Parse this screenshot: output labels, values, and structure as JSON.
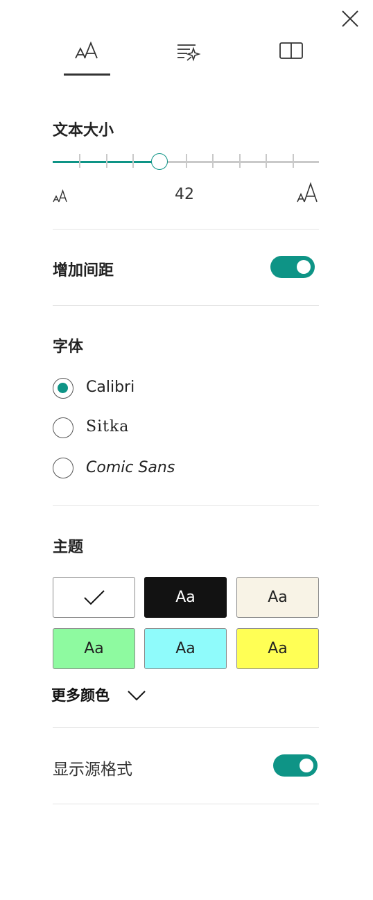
{
  "tabs": [
    {
      "id": "text-options",
      "icon": "text-size-icon",
      "selected": true
    },
    {
      "id": "grammar-options",
      "icon": "text-sparkle-icon",
      "selected": false
    },
    {
      "id": "reading-preferences",
      "icon": "book-icon",
      "selected": false
    }
  ],
  "text_size": {
    "title": "文本大小",
    "value": "42",
    "slider_fraction": 0.4
  },
  "spacing": {
    "label": "增加间距",
    "on": true
  },
  "font": {
    "title": "字体",
    "options": [
      {
        "label": "Calibri",
        "selected": true
      },
      {
        "label": "Sitka",
        "selected": false
      },
      {
        "label": "Comic Sans",
        "selected": false
      }
    ]
  },
  "theme": {
    "title": "主题",
    "sample": "Aa",
    "swatches": [
      {
        "bg": "#ffffff",
        "fg": "#111111",
        "selected": true
      },
      {
        "bg": "#121212",
        "fg": "#ffffff",
        "selected": false
      },
      {
        "bg": "#f8f3e6",
        "fg": "#222222",
        "selected": false
      },
      {
        "bg": "#8efaa0",
        "fg": "#222222",
        "selected": false
      },
      {
        "bg": "#8ffbfb",
        "fg": "#222222",
        "selected": false
      },
      {
        "bg": "#ffff55",
        "fg": "#222222",
        "selected": false
      }
    ],
    "more_colors": "更多颜色"
  },
  "source_format": {
    "label": "显示源格式",
    "on": true
  },
  "colors": {
    "accent": "#0e9486"
  }
}
